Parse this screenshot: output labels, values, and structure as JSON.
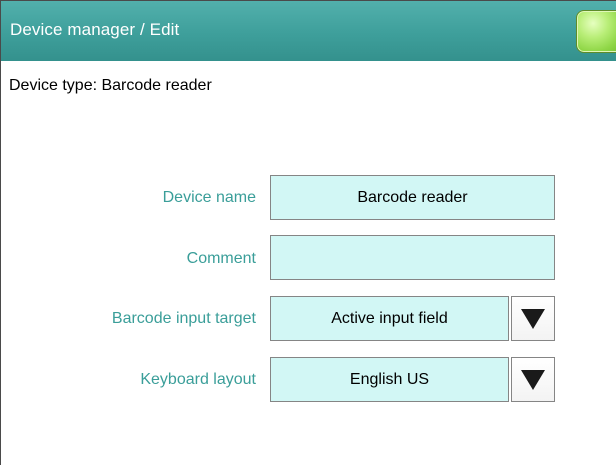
{
  "header": {
    "title": "Device manager / Edit",
    "ok_button_color": "#8fd646",
    "background_color": "#3e9f9b"
  },
  "device_type_line": "Device type: Barcode reader",
  "form": {
    "device_name": {
      "label": "Device name",
      "value": "Barcode reader"
    },
    "comment": {
      "label": "Comment",
      "value": ""
    },
    "barcode_input_target": {
      "label": "Barcode input target",
      "value": "Active input field",
      "dropdown_icon": "triangle-down-icon"
    },
    "keyboard_layout": {
      "label": "Keyboard layout",
      "value": "English US",
      "dropdown_icon": "triangle-down-icon"
    }
  },
  "colors": {
    "label_text": "#3a9e99",
    "field_background": "#d2f7f5"
  }
}
